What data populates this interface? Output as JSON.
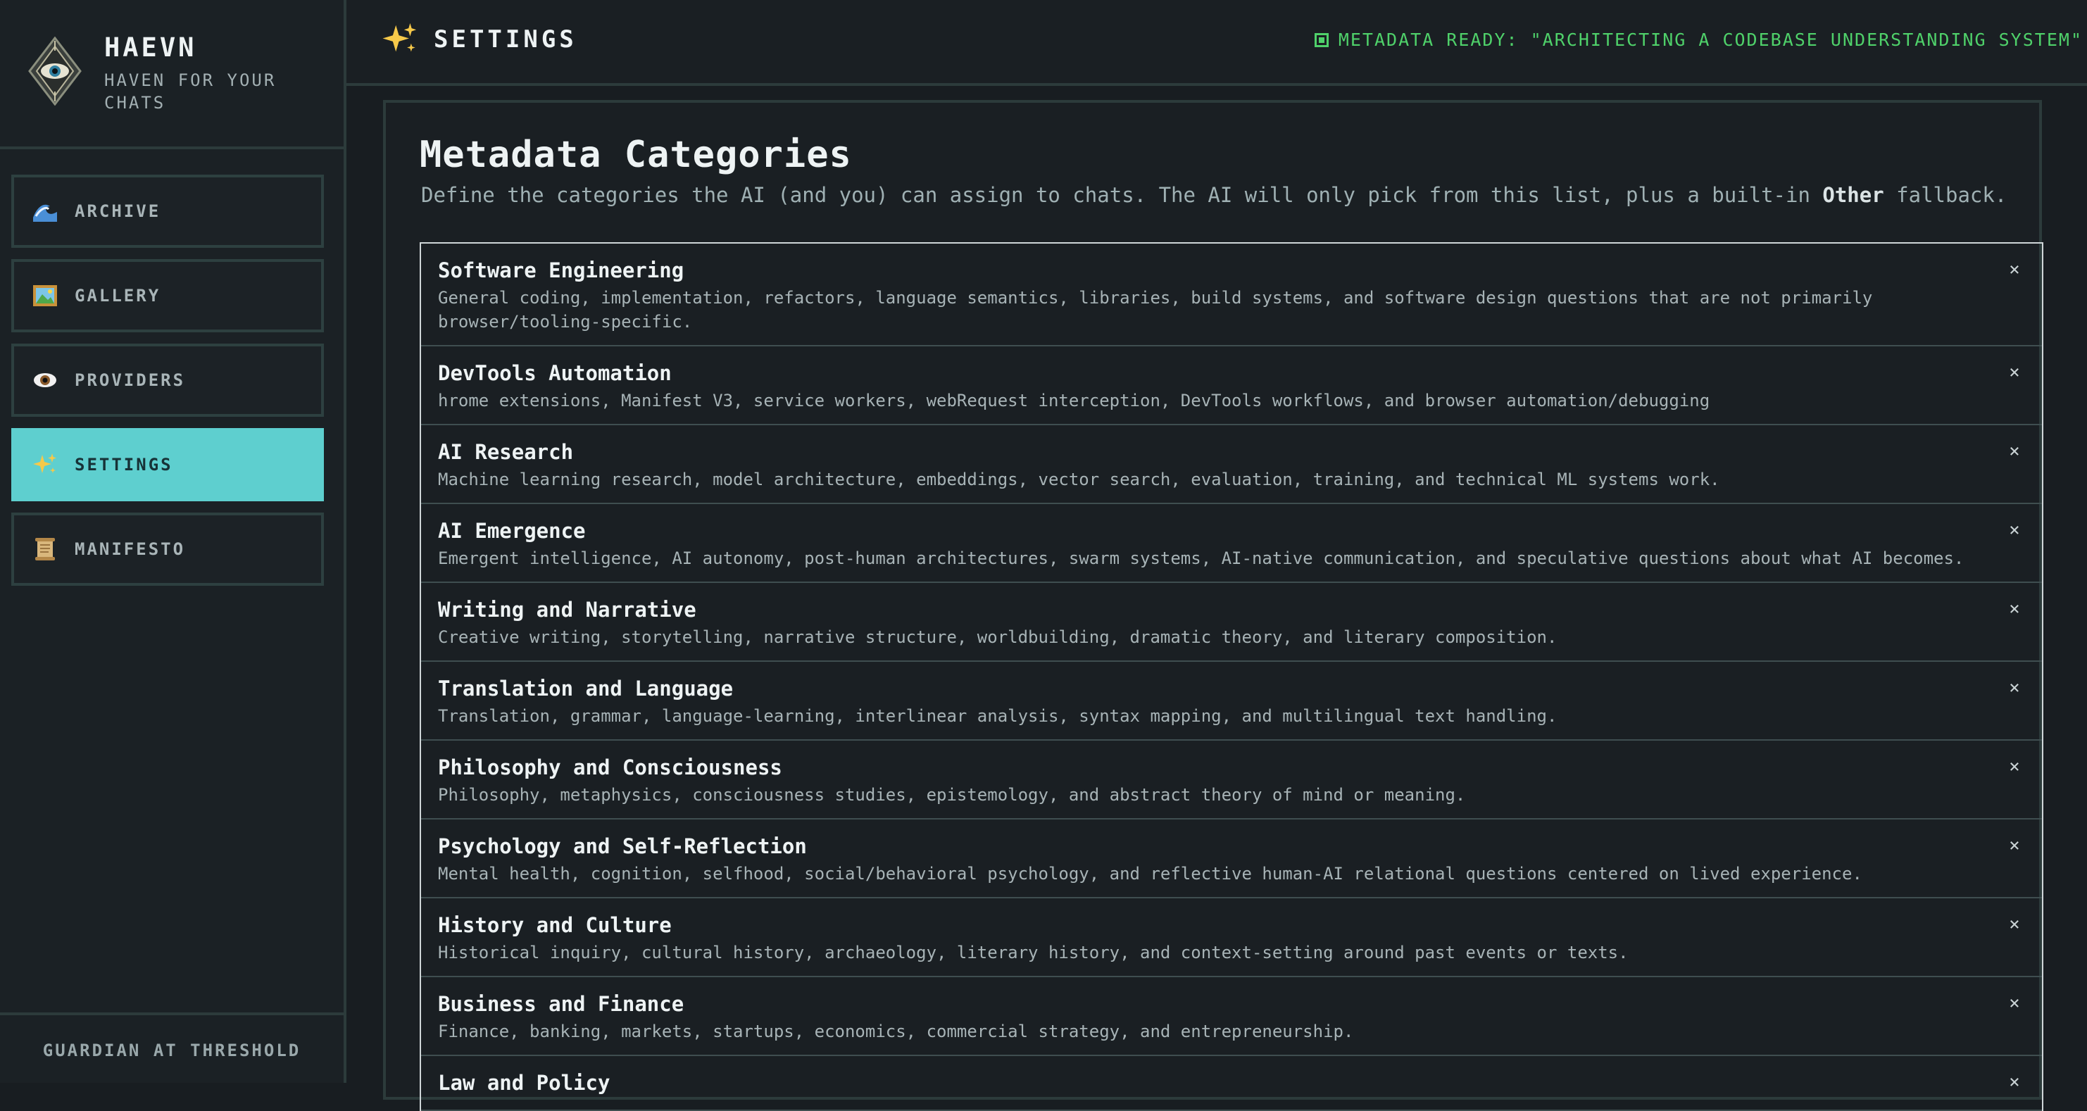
{
  "brand": {
    "title": "HAEVN",
    "subtitle": "HAVEN FOR YOUR CHATS",
    "logo_icon": "eye-emblem-icon"
  },
  "sidebar": {
    "items": [
      {
        "label": "ARCHIVE",
        "icon": "wave-icon"
      },
      {
        "label": "GALLERY",
        "icon": "framed-picture-icon"
      },
      {
        "label": "PROVIDERS",
        "icon": "eye-icon"
      },
      {
        "label": "SETTINGS",
        "icon": "sparkles-icon",
        "active": true
      },
      {
        "label": "MANIFESTO",
        "icon": "scroll-icon"
      }
    ],
    "footer": "GUARDIAN AT THRESHOLD"
  },
  "header": {
    "title": "SETTINGS",
    "icon": "sparkles-icon",
    "status": "METADATA READY: \"ARCHITECTING A CODEBASE UNDERSTANDING SYSTEM\""
  },
  "panel": {
    "title": "Metadata Categories",
    "desc_before": "Define the categories the AI (and you) can assign to chats. The AI will only pick from this list, plus a built-in ",
    "desc_bold": "Other",
    "desc_after": " fallback."
  },
  "categories": [
    {
      "name": "Software Engineering",
      "desc": "General coding, implementation, refactors, language semantics, libraries, build systems, and software design questions that are not primarily browser/tooling-specific."
    },
    {
      "name": "DevTools Automation",
      "desc": "hrome extensions, Manifest V3, service workers, webRequest interception, DevTools workflows, and browser automation/debugging"
    },
    {
      "name": "AI Research",
      "desc": "Machine learning research, model architecture, embeddings, vector search, evaluation, training, and technical ML systems work."
    },
    {
      "name": "AI Emergence",
      "desc": "Emergent intelligence, AI autonomy, post-human architectures, swarm systems, AI-native communication, and speculative questions about what AI becomes."
    },
    {
      "name": "Writing and Narrative",
      "desc": "Creative writing, storytelling, narrative structure, worldbuilding, dramatic theory, and literary composition."
    },
    {
      "name": "Translation and Language",
      "desc": "Translation, grammar, language-learning, interlinear analysis, syntax mapping, and multilingual text handling."
    },
    {
      "name": "Philosophy and Consciousness",
      "desc": "Philosophy, metaphysics, consciousness studies, epistemology, and abstract theory of mind or meaning."
    },
    {
      "name": "Psychology and Self-Reflection",
      "desc": "Mental health, cognition, selfhood, social/behavioral psychology, and reflective human-AI relational questions centered on lived experience."
    },
    {
      "name": "History and Culture",
      "desc": "Historical inquiry, cultural history, archaeology, literary history, and context-setting around past events or texts."
    },
    {
      "name": "Business and Finance",
      "desc": "Finance, banking, markets, startups, economics, commercial strategy, and entrepreneurship."
    },
    {
      "name": "Law and Policy",
      "desc": ""
    }
  ],
  "remove_glyph": "×",
  "colors": {
    "accent": "#5ecfcf",
    "status_green": "#4fd16a",
    "background": "#181d21"
  }
}
